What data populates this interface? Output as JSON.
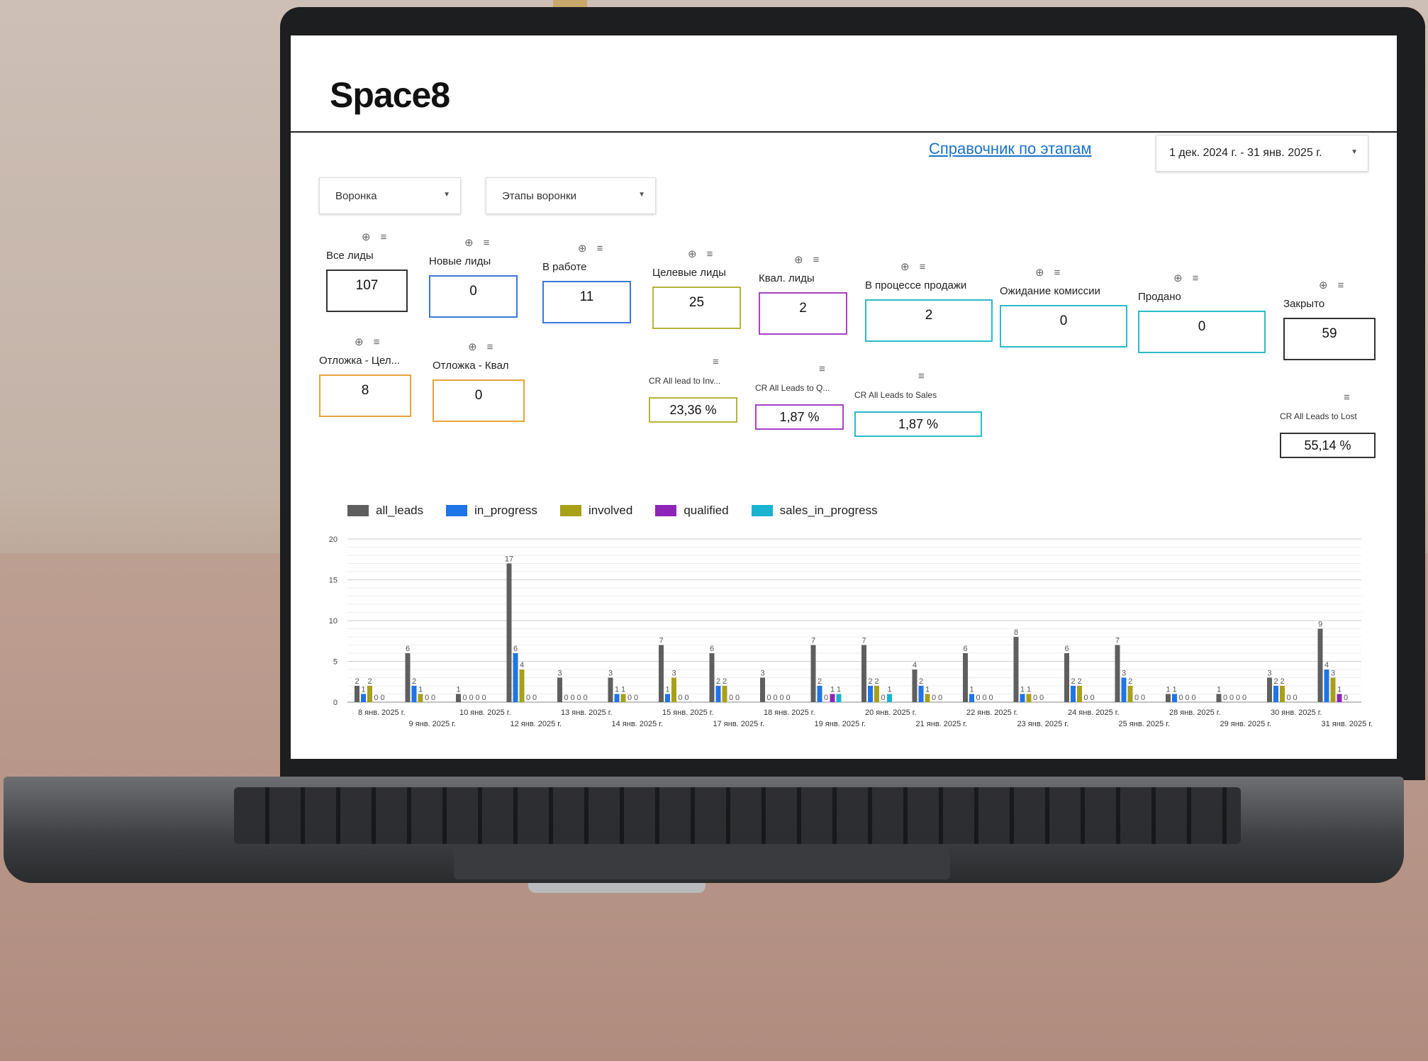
{
  "app": {
    "brand": "Space8",
    "reference_link": "Справочник по этапам",
    "date_range": "1 дек. 2024 г. - 31 янв. 2025 г."
  },
  "filters": {
    "funnel": "Воронка",
    "funnel_stages": "Этапы воронки"
  },
  "icons": {
    "zoom": "zoom-icon",
    "filter": "filter-icon",
    "caret": "chevron-down-icon"
  },
  "tiles": [
    {
      "label": "Все лиды",
      "value": "107",
      "color": "#333333"
    },
    {
      "label": "Новые лиды",
      "value": "0",
      "color": "#3b78d8"
    },
    {
      "label": "В работе",
      "value": "11",
      "color": "#3b78d8"
    },
    {
      "label": "Целевые лиды",
      "value": "25",
      "color": "#b5b53a"
    },
    {
      "label": "Квал. лиды",
      "value": "2",
      "color": "#a742c4"
    },
    {
      "label": "В процессе продажи",
      "value": "2",
      "color": "#2bbcc8"
    },
    {
      "label": "Ожидание комиссии",
      "value": "0",
      "color": "#2bbcc8"
    },
    {
      "label": "Продано",
      "value": "0",
      "color": "#2bbcc8"
    },
    {
      "label": "Закрыто",
      "value": "59",
      "color": "#333333"
    },
    {
      "label": "Отложка - Цел...",
      "value": "8",
      "color": "#e8a33a"
    },
    {
      "label": "Отложка - Квал",
      "value": "0",
      "color": "#e8a33a"
    }
  ],
  "conversion": [
    {
      "label": "CR All lead to Inv...",
      "value": "23,36 %",
      "color": "#b5b53a"
    },
    {
      "label": "CR All Leads to Q...",
      "value": "1,87 %",
      "color": "#a742c4"
    },
    {
      "label": "CR All Leads to Sales",
      "value": "1,87 %",
      "color": "#2bbcc8"
    },
    {
      "label": "CR All Leads to Lost",
      "value": "55,14 %",
      "color": "#333333"
    }
  ],
  "chart_data": {
    "type": "bar",
    "ylim": [
      0,
      20
    ],
    "yticks": [
      0,
      5,
      10,
      15,
      20
    ],
    "grid": true,
    "legend_position": "top-left",
    "categories": [
      "8 янв. 2025 г.",
      "9 янв. 2025 г.",
      "10 янв. 2025 г.",
      "12 янв. 2025 г.",
      "13 янв. 2025 г.",
      "14 янв. 2025 г.",
      "15 янв. 2025 г.",
      "17 янв. 2025 г.",
      "18 янв. 2025 г.",
      "19 янв. 2025 г.",
      "20 янв. 2025 г.",
      "21 янв. 2025 г.",
      "22 янв. 2025 г.",
      "23 янв. 2025 г.",
      "24 янв. 2025 г.",
      "25 янв. 2025 г.",
      "28 янв. 2025 г.",
      "29 янв. 2025 г.",
      "30 янв. 2025 г.",
      "31 янв. 2025 г."
    ],
    "series": [
      {
        "name": "all_leads",
        "color": "#5f5f5f",
        "values": [
          2,
          6,
          1,
          17,
          3,
          3,
          7,
          6,
          3,
          7,
          7,
          4,
          6,
          8,
          6,
          7,
          1,
          1,
          3,
          9
        ]
      },
      {
        "name": "in_progress",
        "color": "#1f74e6",
        "values": [
          1,
          2,
          0,
          6,
          0,
          1,
          1,
          2,
          0,
          2,
          2,
          2,
          1,
          1,
          2,
          3,
          1,
          0,
          2,
          4
        ]
      },
      {
        "name": "involved",
        "color": "#a9a01a",
        "values": [
          2,
          1,
          0,
          4,
          0,
          1,
          3,
          2,
          0,
          0,
          2,
          1,
          0,
          1,
          2,
          2,
          0,
          0,
          2,
          3
        ]
      },
      {
        "name": "qualified",
        "color": "#8c25b8",
        "values": [
          0,
          0,
          0,
          0,
          0,
          0,
          0,
          0,
          0,
          1,
          0,
          0,
          0,
          0,
          0,
          0,
          0,
          0,
          0,
          1
        ]
      },
      {
        "name": "sales_in_progress",
        "color": "#19b3d1",
        "values": [
          0,
          0,
          0,
          0,
          0,
          0,
          0,
          0,
          0,
          1,
          1,
          0,
          0,
          0,
          0,
          0,
          0,
          0,
          0,
          0
        ]
      }
    ]
  }
}
